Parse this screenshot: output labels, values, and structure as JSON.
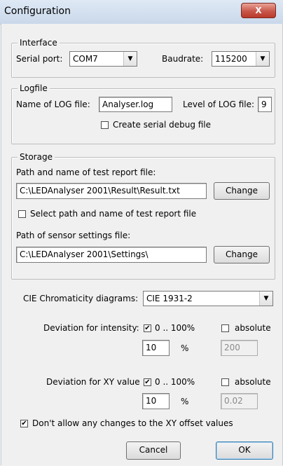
{
  "window": {
    "title": "Configuration",
    "close_icon": "close-icon",
    "close_glyph": "X"
  },
  "interface": {
    "legend": "Interface",
    "serial_port_label": "Serial port:",
    "serial_port_value": "COM7",
    "baudrate_label": "Baudrate:",
    "baudrate_value": "115200"
  },
  "logfile": {
    "legend": "Logfile",
    "name_label": "Name of LOG file:",
    "name_value": "Analyser.log",
    "level_label": "Level of LOG file:",
    "level_value": "9",
    "debug_label": "Create serial debug file",
    "debug_checked": false
  },
  "storage": {
    "legend": "Storage",
    "report_label": "Path and name of test report file:",
    "report_value": "C:\\LEDAnalyser 2001\\Result\\Result.txt",
    "change_label": "Change",
    "select_label": "Select path and name of test report file",
    "select_checked": false,
    "sensor_label": "Path of sensor settings  file:",
    "sensor_value": "C:\\LEDAnalyser 2001\\Settings\\",
    "change2_label": "Change"
  },
  "cie": {
    "label": "CIE Chromaticity diagrams:",
    "value": "CIE 1931-2"
  },
  "intensity": {
    "label": "Deviation for intensity:",
    "percent_label": "0 .. 100%",
    "percent_checked": true,
    "absolute_label": "absolute",
    "absolute_checked": false,
    "value": "10",
    "unit": "%",
    "absolute_value": "200"
  },
  "xy": {
    "label": "Deviation for XY value :",
    "percent_label": "0 .. 100%",
    "percent_checked": true,
    "absolute_label": "absolute",
    "absolute_checked": false,
    "value": "10",
    "unit": "%",
    "absolute_value": "0.02"
  },
  "offset": {
    "label": "Don't allow any changes to the XY offset values",
    "checked": true
  },
  "buttons": {
    "cancel": "Cancel",
    "ok": "OK"
  },
  "glyphs": {
    "check": "✔",
    "dropdown": "▼"
  }
}
